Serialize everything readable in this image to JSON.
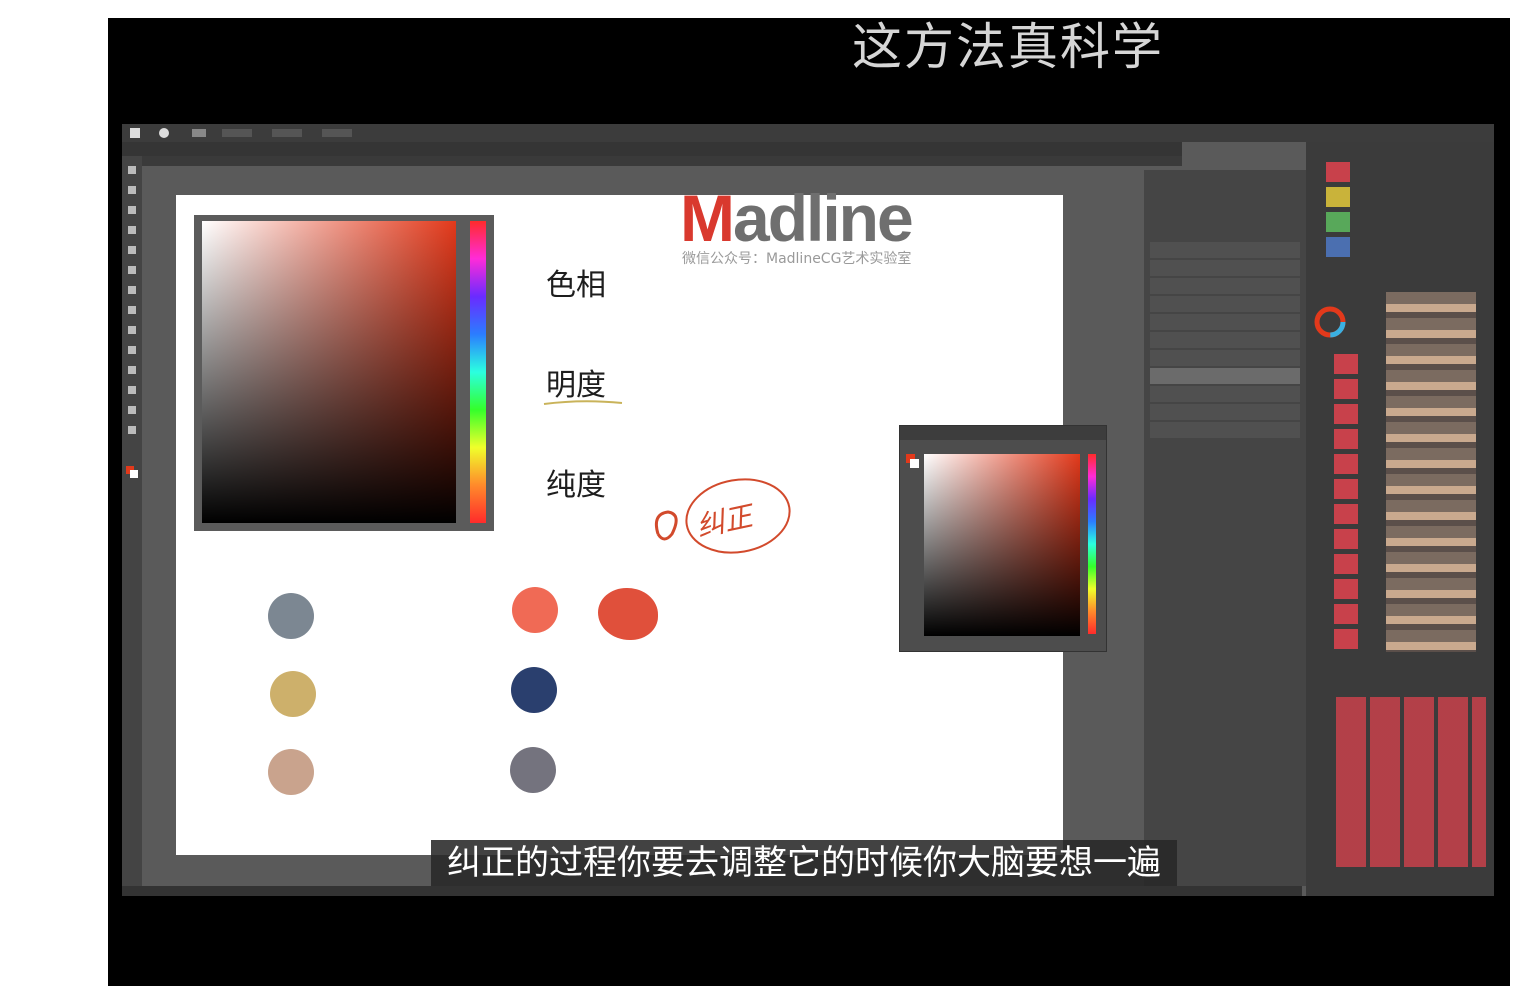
{
  "video": {
    "title": "这方法真科学",
    "subtitle": "纠正的过程你要去调整它的时候你大脑要想一遍"
  },
  "canvas": {
    "labels": [
      "色相",
      "明度",
      "纯度"
    ],
    "annotation": "纠正",
    "logo": {
      "mark": "M",
      "rest": "adline",
      "sub": "微信公众号：MadlineCG艺术实验室"
    },
    "swatches_left": [
      "#7c8792",
      "#cdb06b",
      "#c9a38d"
    ],
    "swatches_right": [
      "#f06a55",
      "#2a3f6e",
      "#74737e"
    ],
    "swatch_paint": "#e0503b"
  },
  "colors": {
    "accent": "#e2391b",
    "panel_red": "#c8414b",
    "ps_bg": "#5a5a5a"
  },
  "icons": [
    "brush-icon",
    "move-icon",
    "eye-icon",
    "gear-icon",
    "lasso-icon"
  ]
}
